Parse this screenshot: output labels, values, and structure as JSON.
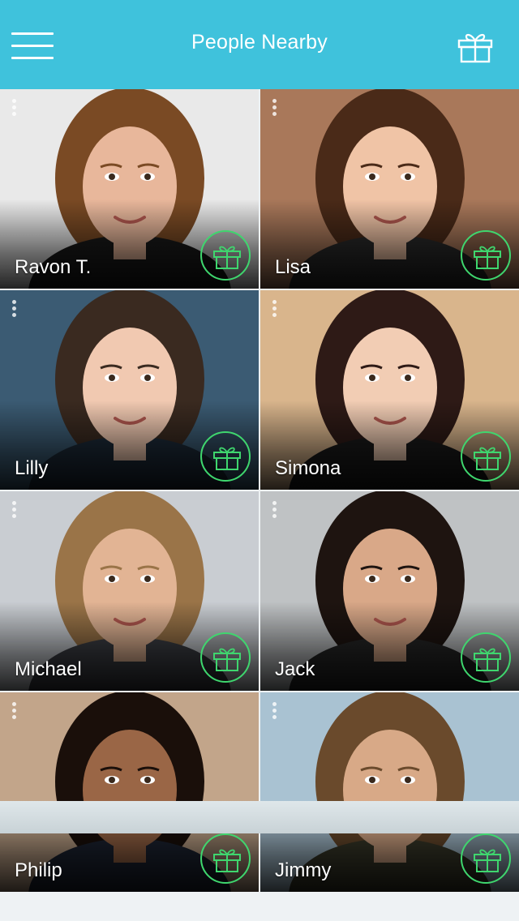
{
  "header": {
    "title": "People Nearby",
    "menu_icon": "hamburger-menu-icon",
    "gift_icon": "gift-icon"
  },
  "colors": {
    "accent": "#3fc2dc",
    "gift_ring": "#3fd66e"
  },
  "people": [
    {
      "name": "Ravon T.",
      "skin": "#e8b79b",
      "hair": "#7a4a24",
      "bg": "#e9e9e9",
      "shirt": "#1a1a1a"
    },
    {
      "name": "Lisa",
      "skin": "#f0c4a6",
      "hair": "#4a2a18",
      "bg": "#a9785a",
      "shirt": "#2a2a2a"
    },
    {
      "name": "Lilly",
      "skin": "#f1c9b1",
      "hair": "#3a2a20",
      "bg": "#3b5b73",
      "shirt": "#1c2a38"
    },
    {
      "name": "Simona",
      "skin": "#f2cdb4",
      "hair": "#2e1a16",
      "bg": "#d9b58c",
      "shirt": "#1a1a1a"
    },
    {
      "name": "Michael",
      "skin": "#e2b494",
      "hair": "#9a7448",
      "bg": "#c9cdd2",
      "shirt": "#3d3f45"
    },
    {
      "name": "Jack",
      "skin": "#d9a888",
      "hair": "#1e1410",
      "bg": "#bfc2c4",
      "shirt": "#262626"
    },
    {
      "name": "Philip",
      "skin": "#9a6646",
      "hair": "#1a0f0a",
      "bg": "#c2a58a",
      "shirt": "#1d2433"
    },
    {
      "name": "Jimmy",
      "skin": "#d8a987",
      "hair": "#6a4a2c",
      "bg": "#a9c2d2",
      "shirt": "#3a3a2a"
    }
  ]
}
